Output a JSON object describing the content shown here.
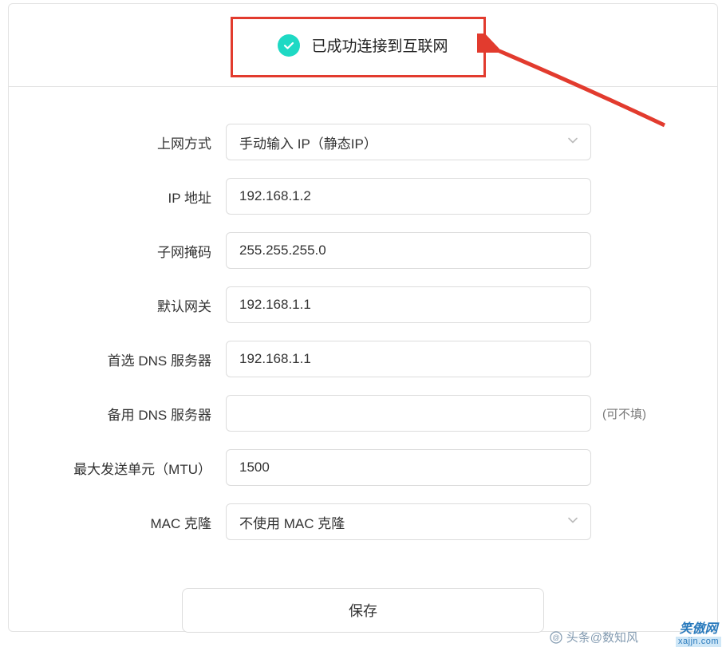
{
  "status": {
    "text": "已成功连接到互联网",
    "icon": "check-circle-icon",
    "icon_color": "#1ed9c4"
  },
  "annotation": {
    "highlight_color": "#e23b2e",
    "arrow_color": "#e23b2e"
  },
  "form": {
    "mode": {
      "label": "上网方式",
      "value": "手动输入 IP（静态IP）"
    },
    "ip": {
      "label": "IP 地址",
      "value": "192.168.1.2"
    },
    "mask": {
      "label": "子网掩码",
      "value": "255.255.255.0"
    },
    "gateway": {
      "label": "默认网关",
      "value": "192.168.1.1"
    },
    "dns1": {
      "label": "首选 DNS 服务器",
      "value": "192.168.1.1"
    },
    "dns2": {
      "label": "备用 DNS 服务器",
      "value": "",
      "hint": "(可不填)"
    },
    "mtu": {
      "label": "最大发送单元（MTU）",
      "value": "1500"
    },
    "mac": {
      "label": "MAC 克隆",
      "value": "不使用 MAC 克隆"
    },
    "save_label": "保存"
  },
  "watermarks": {
    "w1_text": "头条@数知风",
    "w2_top": "笑傲网",
    "w2_bot": "xajjn.com"
  }
}
